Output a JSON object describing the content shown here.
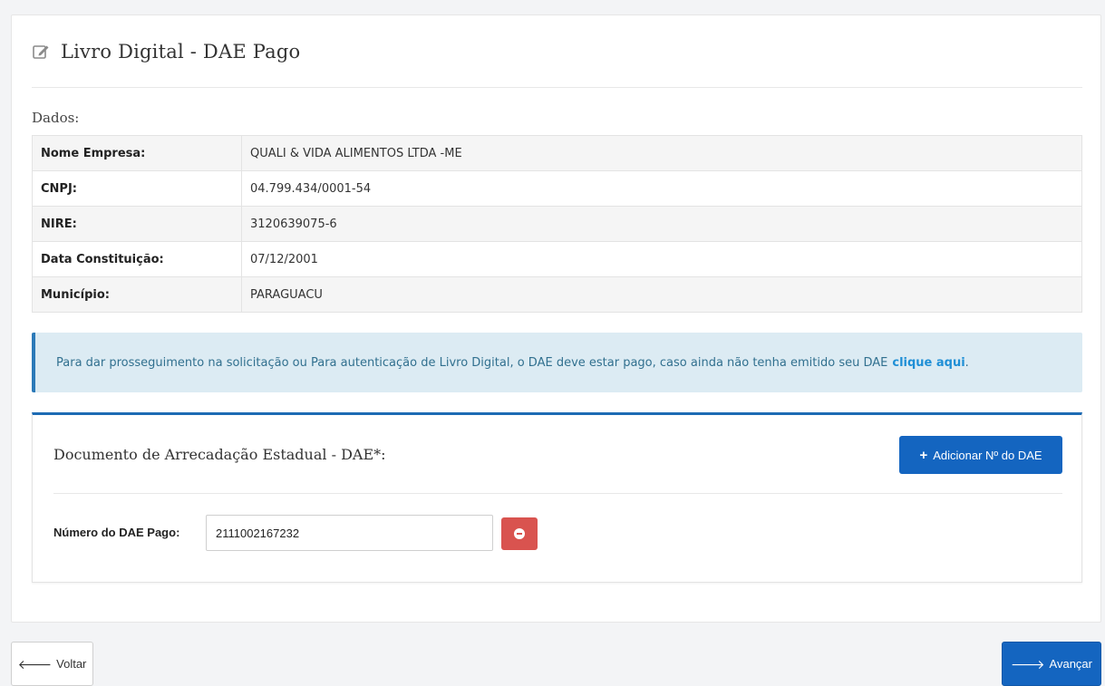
{
  "header": {
    "title": "Livro Digital - DAE Pago",
    "icon": "edit-icon"
  },
  "dados": {
    "section_label": "Dados:",
    "rows": [
      {
        "label": "Nome Empresa:",
        "value": "QUALI & VIDA ALIMENTOS LTDA -ME"
      },
      {
        "label": "CNPJ:",
        "value": "04.799.434/0001-54"
      },
      {
        "label": "NIRE:",
        "value": "3120639075-6"
      },
      {
        "label": "Data Constituição:",
        "value": "07/12/2001"
      },
      {
        "label": "Município:",
        "value": "PARAGUACU"
      }
    ]
  },
  "alert": {
    "text": "Para dar prosseguimento na solicitação ou Para autenticação de Livro Digital, o DAE deve estar pago, caso ainda não tenha emitido seu DAE",
    "link_text": "clique aqui"
  },
  "dae": {
    "title": "Documento de Arrecadação Estadual - DAE*:",
    "add_button": "Adicionar Nº do DAE",
    "field_label": "Número do DAE Pago:",
    "field_value": "2111002167232"
  },
  "footer": {
    "back_label": "Voltar",
    "next_label": "Avançar"
  },
  "colors": {
    "primary": "#1465c0",
    "danger": "#d9534f",
    "alert_bg": "#dcebf3",
    "alert_text": "#31708f"
  }
}
